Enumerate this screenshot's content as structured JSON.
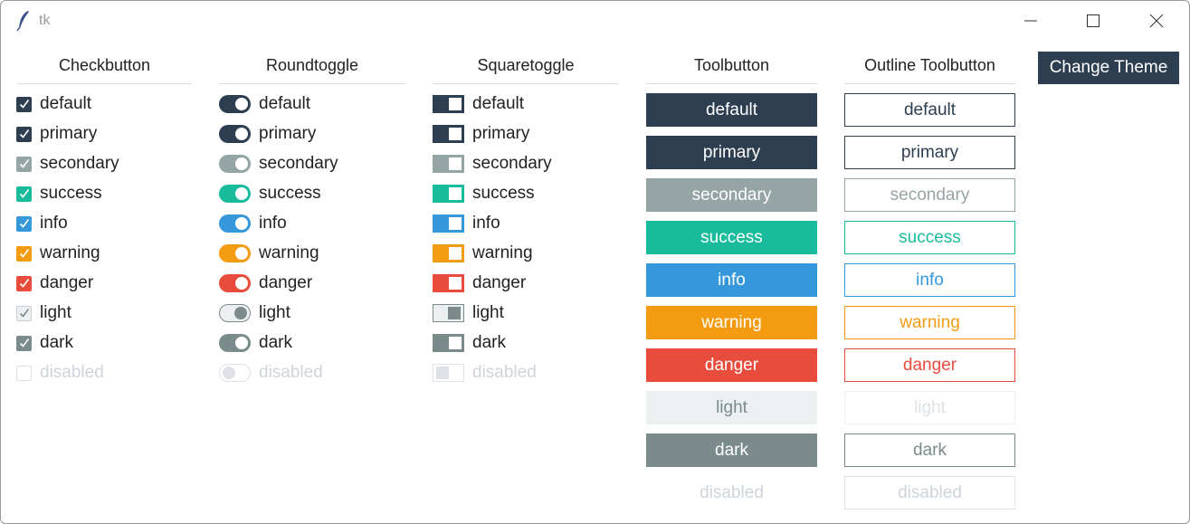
{
  "window": {
    "title": "tk"
  },
  "headers": {
    "checkbutton": "Checkbutton",
    "roundtoggle": "Roundtoggle",
    "squaretoggle": "Squaretoggle",
    "toolbutton": "Toolbutton",
    "outline_toolbutton": "Outline Toolbutton"
  },
  "change_theme": "Change Theme",
  "colors": {
    "default": "#2c3e50",
    "primary": "#2c3e50",
    "secondary": "#95a5a6",
    "success": "#18bc9c",
    "info": "#3498db",
    "warning": "#f39c12",
    "danger": "#e74c3c",
    "light": "#ecf0f1",
    "dark": "#7b8a8b",
    "disabled": "#ced4da"
  },
  "styles": [
    {
      "name": "default",
      "label": "default"
    },
    {
      "name": "primary",
      "label": "primary"
    },
    {
      "name": "secondary",
      "label": "secondary"
    },
    {
      "name": "success",
      "label": "success"
    },
    {
      "name": "info",
      "label": "info"
    },
    {
      "name": "warning",
      "label": "warning"
    },
    {
      "name": "danger",
      "label": "danger"
    },
    {
      "name": "light",
      "label": "light"
    },
    {
      "name": "dark",
      "label": "dark"
    },
    {
      "name": "disabled",
      "label": "disabled"
    }
  ],
  "checked": [
    true,
    true,
    true,
    true,
    true,
    true,
    true,
    true,
    true,
    false
  ]
}
